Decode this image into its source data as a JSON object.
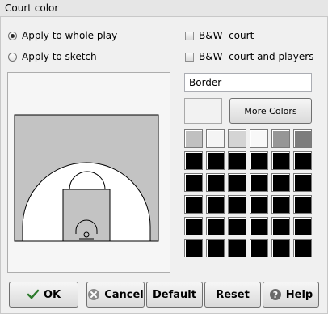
{
  "window": {
    "title": "Court color"
  },
  "options": {
    "apply_whole_play": "Apply to whole play",
    "apply_sketch": "Apply to sketch",
    "bw_court": "B&W  court",
    "bw_court_players": "B&W  court and players"
  },
  "border": {
    "label": "Border"
  },
  "colors": {
    "current": "#f2f2f2",
    "more_colors_label": "More Colors",
    "palette": [
      [
        "#c0c0c0",
        "#f4f4f4",
        "#d4d4d4",
        "#f8f8f8",
        "#969696",
        "#7d7d7d"
      ],
      [
        "#000000",
        "#000000",
        "#000000",
        "#000000",
        "#000000",
        "#000000"
      ],
      [
        "#000000",
        "#000000",
        "#000000",
        "#000000",
        "#000000",
        "#000000"
      ],
      [
        "#000000",
        "#000000",
        "#000000",
        "#000000",
        "#000000",
        "#000000"
      ],
      [
        "#000000",
        "#000000",
        "#000000",
        "#000000",
        "#000000",
        "#000000"
      ],
      [
        "#000000",
        "#000000",
        "#000000",
        "#000000",
        "#000000",
        "#000000"
      ]
    ]
  },
  "court": {
    "floor_color": "#c3c3c3",
    "key_color": "#c3c3c3",
    "arc_fill": "#ffffff"
  },
  "buttons": {
    "ok": "OK",
    "cancel": "Cancel",
    "default": "Default",
    "reset": "Reset",
    "help": "Help"
  }
}
